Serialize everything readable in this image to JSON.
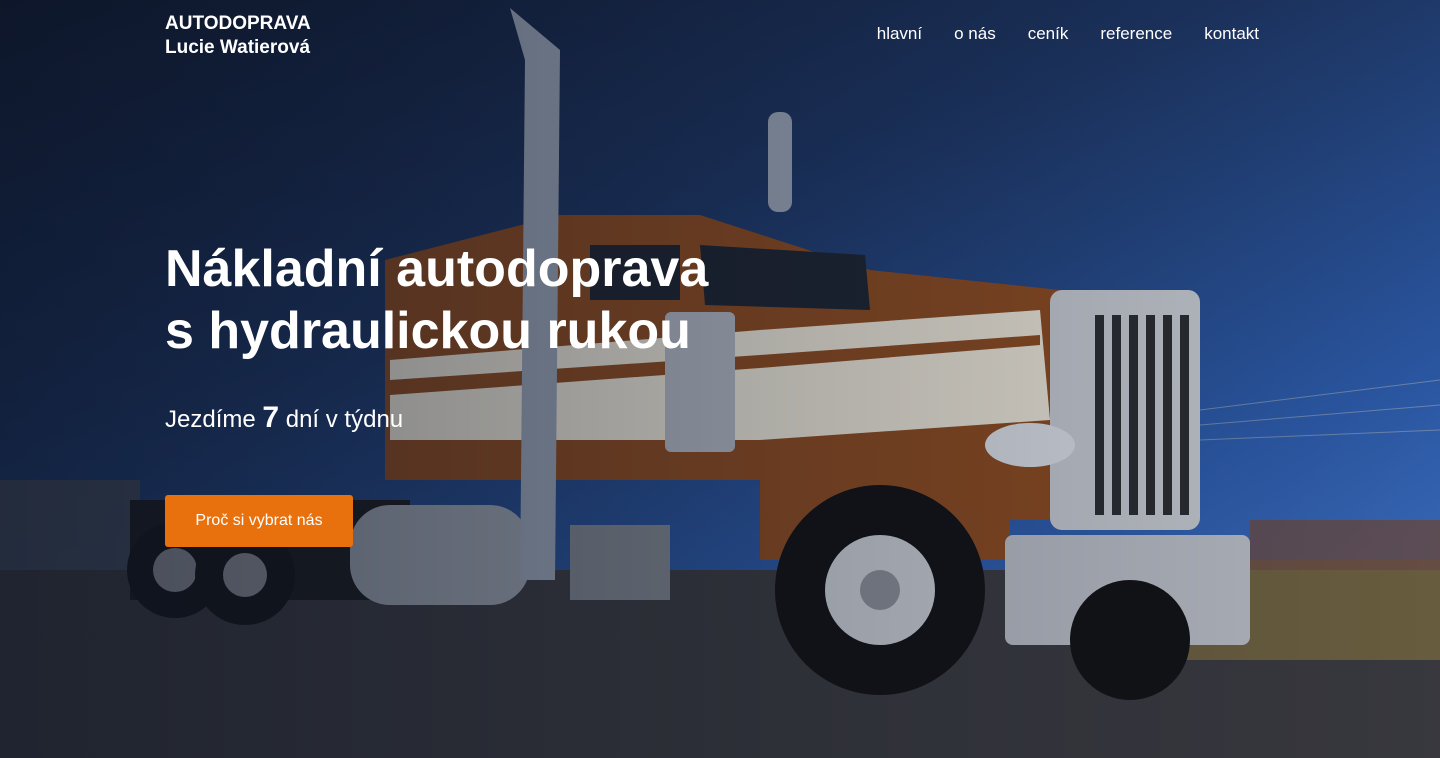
{
  "brand": {
    "line1": "AUTODOPRAVA",
    "line2": "Lucie Watierová"
  },
  "nav": [
    {
      "label": "hlavní"
    },
    {
      "label": "o nás"
    },
    {
      "label": "ceník"
    },
    {
      "label": "reference"
    },
    {
      "label": "kontakt"
    }
  ],
  "hero": {
    "title_line1": "Nákladní autodoprava",
    "title_line2": "s hydraulickou rukou",
    "subtitle_prefix": "Jezdíme",
    "subtitle_number": "7",
    "subtitle_suffix": "dní v týdnu",
    "cta_label": "Proč si vybrat nás",
    "background_image": "truck-photo"
  },
  "colors": {
    "accent": "#e8700d",
    "sky": "#2c5aa8",
    "text": "#ffffff"
  }
}
